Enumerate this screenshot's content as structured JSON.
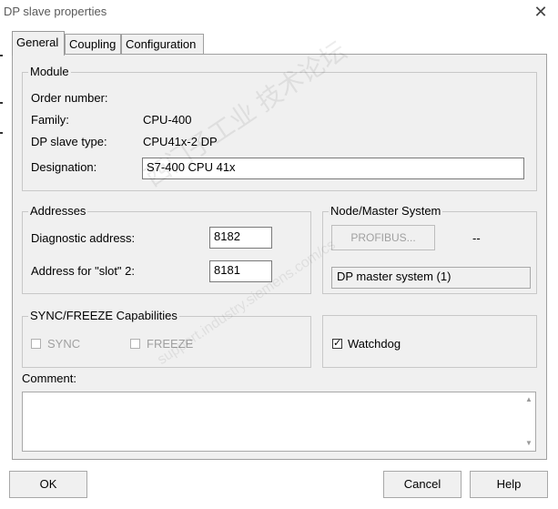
{
  "window": {
    "title": "DP slave properties",
    "close_glyph": "✕"
  },
  "tabs": [
    {
      "label": "General",
      "active": true
    },
    {
      "label": "Coupling",
      "active": false
    },
    {
      "label": "Configuration",
      "active": false
    }
  ],
  "module": {
    "legend": "Module",
    "order_number_label": "Order number:",
    "order_number_value": "",
    "family_label": "Family:",
    "family_value": "CPU-400",
    "dp_slave_type_label": "DP slave type:",
    "dp_slave_type_value": "CPU41x-2 DP",
    "designation_label": "Designation:",
    "designation_value": "S7-400 CPU 41x"
  },
  "addresses": {
    "legend": "Addresses",
    "diagnostic_label": "Diagnostic address:",
    "diagnostic_value": "8182",
    "slot2_label": "Address for \"slot\" 2:",
    "slot2_value": "8181"
  },
  "node_master": {
    "legend": "Node/Master System",
    "profibus_button": "PROFIBUS...",
    "node_value": "--",
    "master_system_value": "DP master system (1)"
  },
  "sync_freeze": {
    "legend": "SYNC/FREEZE Capabilities",
    "sync_label": "SYNC",
    "sync_checked": false,
    "freeze_label": "FREEZE",
    "freeze_checked": false
  },
  "watchdog": {
    "label": "Watchdog",
    "checked": true
  },
  "comment": {
    "label": "Comment:",
    "value": ""
  },
  "buttons": {
    "ok": "OK",
    "cancel": "Cancel",
    "help": "Help"
  },
  "watermark": {
    "text1": "西门子工业 技术论坛",
    "text2": "support.industry.siemens.com/cs"
  }
}
